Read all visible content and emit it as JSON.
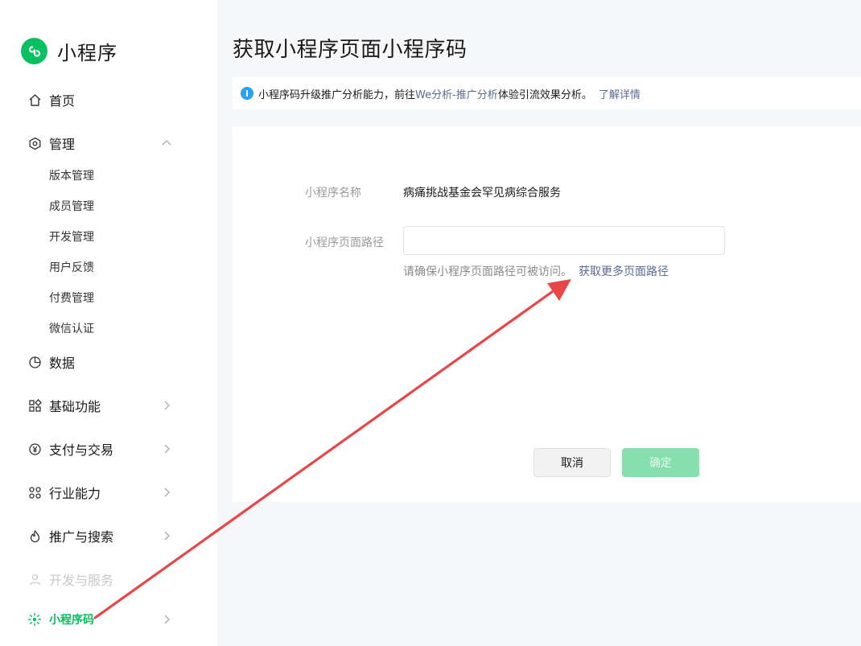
{
  "sidebar": {
    "brand": "小程序",
    "items": [
      {
        "label": "首页"
      },
      {
        "label": "管理"
      },
      {
        "label": "数据"
      },
      {
        "label": "基础功能"
      },
      {
        "label": "支付与交易"
      },
      {
        "label": "行业能力"
      },
      {
        "label": "推广与搜索"
      },
      {
        "label": "开发与服务"
      },
      {
        "label": "小程序码"
      }
    ],
    "sub_items": [
      {
        "label": "版本管理"
      },
      {
        "label": "成员管理"
      },
      {
        "label": "开发管理"
      },
      {
        "label": "用户反馈"
      },
      {
        "label": "付费管理"
      },
      {
        "label": "微信认证"
      }
    ]
  },
  "main": {
    "title": "获取小程序页面小程序码",
    "notice": {
      "text_before": "小程序码升级推广分析能力，前往",
      "link": "We分析-推广分析",
      "text_after": "体验引流效果分析。",
      "more": "了解详情"
    },
    "form": {
      "name_label": "小程序名称",
      "name_value": "病痛挑战基金会罕见病综合服务",
      "path_label": "小程序页面路径",
      "path_value": "",
      "hint": "请确保小程序页面路径可被访问。",
      "hint_link": "获取更多页面路径"
    },
    "buttons": {
      "cancel": "取消",
      "ok": "确定"
    }
  },
  "colors": {
    "accent": "#07c160",
    "link": "#576b95",
    "annotation_arrow": "#e8474a"
  }
}
